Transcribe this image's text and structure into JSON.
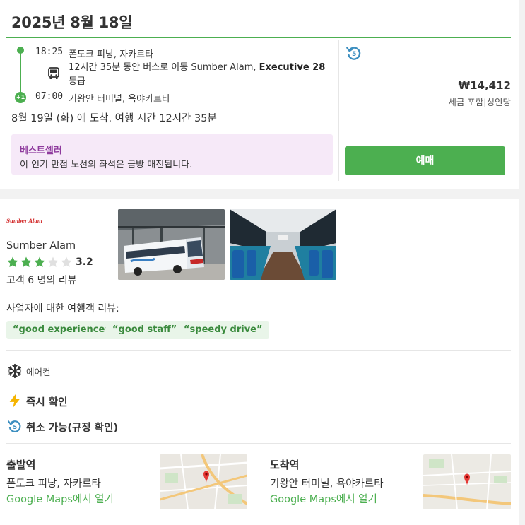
{
  "trip": {
    "date": "2025년 8월 18일",
    "departure_time": "18:25",
    "departure_place": "폰도크 피낭, 자카르타",
    "description": "12시간 35분 동안 버스로 이동 Sumber Alam,",
    "service_class": "Executive 28",
    "class_suffix": "등급",
    "arrival_time": "07:00",
    "day_offset": "+1",
    "arrival_place": "기왕안 터미널, 욕야카르타",
    "arrival_summary": "8월 19일 (화) 에 도착. 여행 시간 12시간 35분"
  },
  "bestseller": {
    "title": "베스트셀러",
    "text": "이 인기 만점 노선의 좌석은 금방 매진됩니다."
  },
  "booking": {
    "price": "₩14,412",
    "price_note": "세금 포함|성인당",
    "book_label": "예매",
    "refund_icon": "refund-icon"
  },
  "operator": {
    "logo_text": "Sumber Alam",
    "name": "Sumber Alam",
    "rating": "3.2",
    "rating_value": 3.2,
    "stars_filled": 3,
    "stars_total": 5,
    "review_count": "고객 6 명의 리뷰"
  },
  "reviews": {
    "title": "사업자에 대한 여행객 리뷰:",
    "tags": [
      "“good experience”",
      "“good staff”",
      "“speedy drive”"
    ]
  },
  "amenities": [
    {
      "icon": "snowflake-icon",
      "label": "에어컨"
    },
    {
      "icon": "lightning-icon",
      "label": "즉시 확인"
    },
    {
      "icon": "refund-icon",
      "label": "취소 가능(규정 확인)"
    }
  ],
  "stations": {
    "departure": {
      "title": "출발역",
      "name": "폰도크 피낭, 자카르타",
      "link": "Google Maps에서 열기"
    },
    "arrival": {
      "title": "도착역",
      "name": "기왕안 터미널, 욕야카르타",
      "link": "Google Maps에서 열기"
    }
  },
  "colors": {
    "accent": "#4caf50",
    "bestseller_bg": "#f6e9f8",
    "bestseller_title": "#8e3a9d",
    "tag_bg": "#e9f5e9",
    "star": "#4caf50",
    "refund_blue": "#3d8fc0"
  }
}
